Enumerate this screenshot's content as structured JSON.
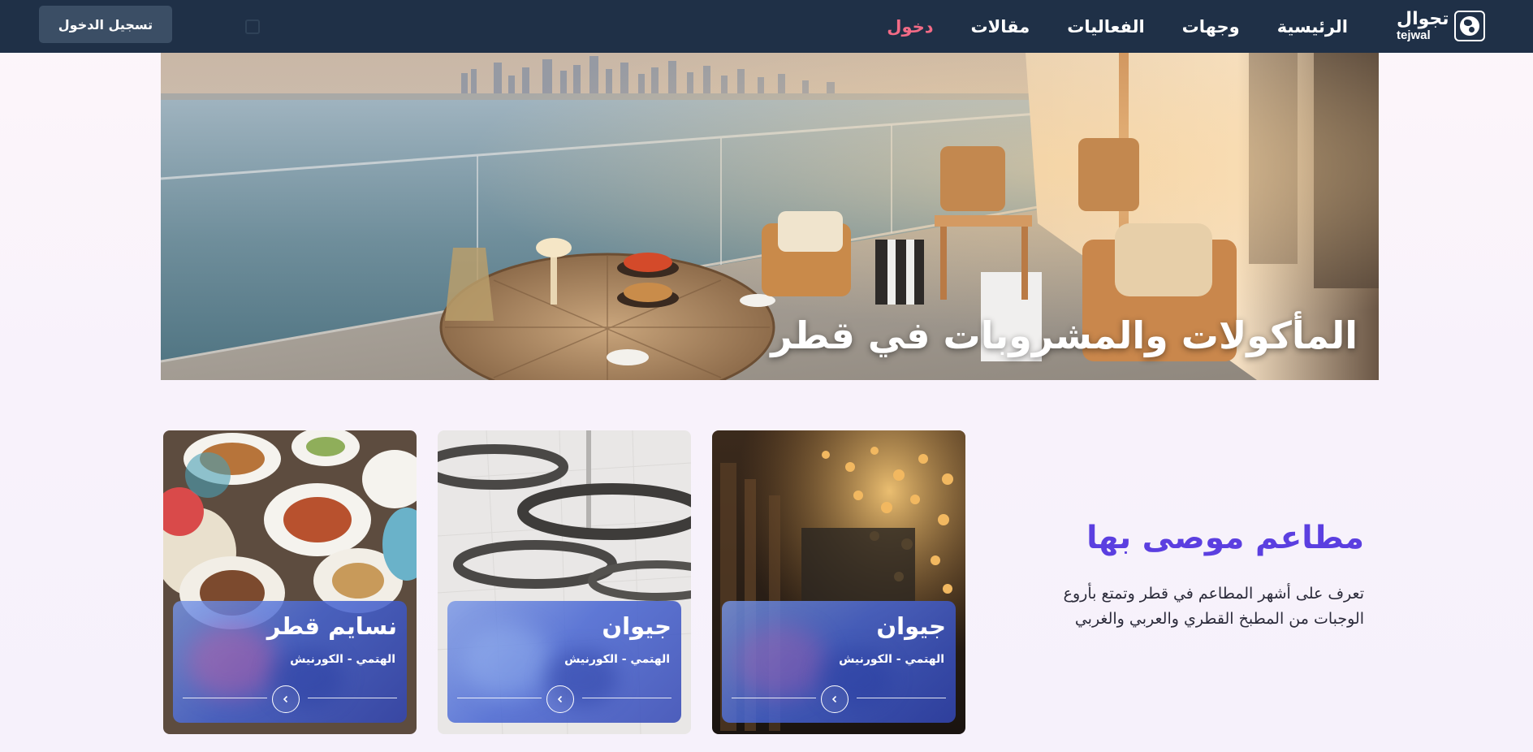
{
  "brand": {
    "name_ar": "تجوال",
    "name_en": "tejwal"
  },
  "nav": {
    "links": [
      {
        "label": "الرئيسية"
      },
      {
        "label": "وجهات"
      },
      {
        "label": "الفعاليات"
      },
      {
        "label": "مقالات"
      },
      {
        "label": "دخول"
      }
    ],
    "signup_label": "تسجيل الدخول"
  },
  "hero": {
    "title": "المأكولات والمشروبات في قطر"
  },
  "recommended": {
    "title": "مطاعم موصى بها",
    "description": "تعرف على أشهر المطاعم في قطر وتمتع بأروع الوجبات من المطبخ القطري والعربي والغربي"
  },
  "cards": [
    {
      "name": "جيوان",
      "location": "الهتمي - الكورنيش"
    },
    {
      "name": "جيوان",
      "location": "الهتمي - الكورنيش"
    },
    {
      "name": "نسايم قطر",
      "location": "الهتمي - الكورنيش"
    }
  ],
  "colors": {
    "navbar": "#1f3047",
    "nav_active": "#f36b86",
    "section_title": "#5b3fe0",
    "signup_bg": "#3b4e65"
  }
}
